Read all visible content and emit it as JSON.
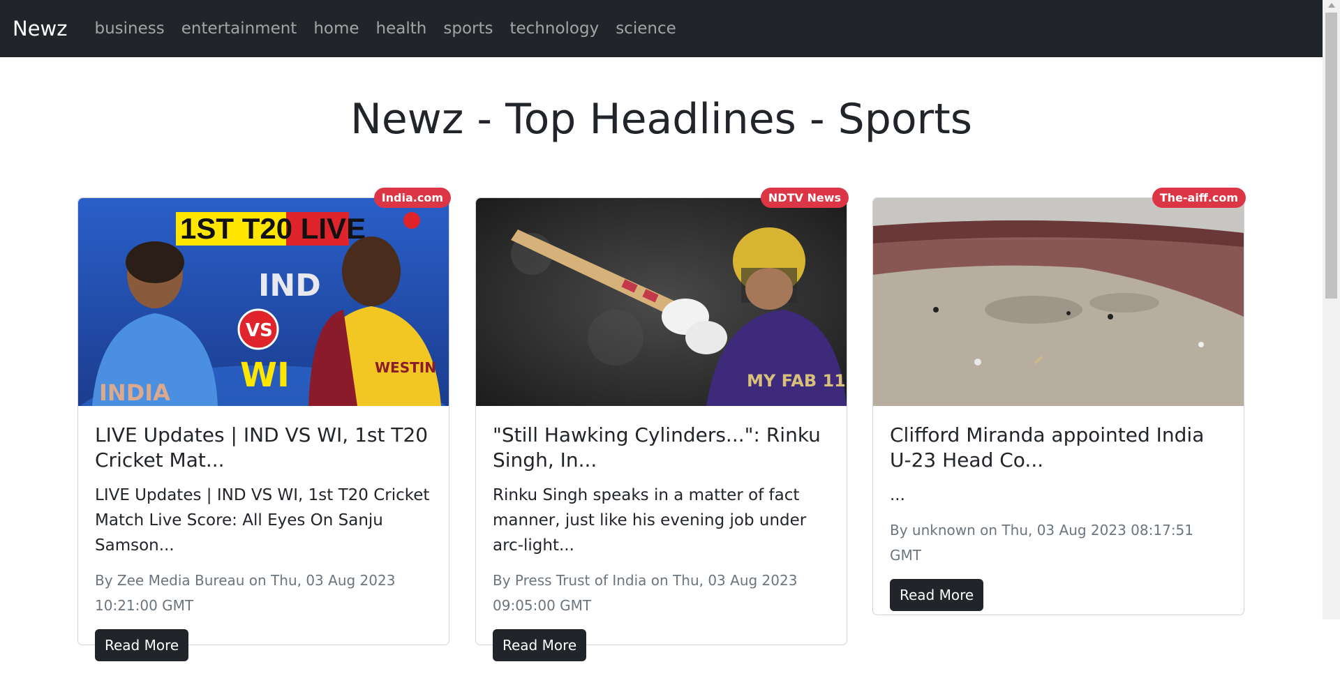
{
  "navbar": {
    "brand": "Newz",
    "links": [
      "business",
      "entertainment",
      "home",
      "health",
      "sports",
      "technology",
      "science"
    ]
  },
  "page": {
    "title": "Newz - Top Headlines - Sports"
  },
  "articles": [
    {
      "source": "India.com",
      "title": "LIVE Updates | IND VS WI, 1st T20 Cricket Mat...",
      "description": "LIVE Updates | IND VS WI, 1st T20 Cricket Match Live Score: All Eyes On Sanju Samson...",
      "meta": "By Zee Media Bureau on Thu, 03 Aug 2023 10:21:00 GMT",
      "button": "Read More",
      "image_text": {
        "headline": "1ST T20 LIVE",
        "team1": "IND",
        "vs": "VS",
        "team2": "WI",
        "jersey1": "INDIA",
        "jersey2": "WESTIN"
      }
    },
    {
      "source": "NDTV News",
      "title": "\"Still Hawking Cylinders...\": Rinku Singh, In...",
      "description": "Rinku Singh speaks in a matter of fact manner, just like his evening job under arc-light...",
      "meta": "By Press Trust of India on Thu, 03 Aug 2023 09:05:00 GMT",
      "button": "Read More",
      "image_text": {
        "jersey": "MY FAB 11"
      }
    },
    {
      "source": "The-aiff.com",
      "title": "Clifford Miranda appointed India U-23 Head Co...",
      "description": "...",
      "meta": "By unknown on Thu, 03 Aug 2023 08:17:51 GMT",
      "button": "Read More"
    }
  ],
  "colors": {
    "navbar": "#212529",
    "badge": "#dc3545",
    "button": "#212529"
  }
}
